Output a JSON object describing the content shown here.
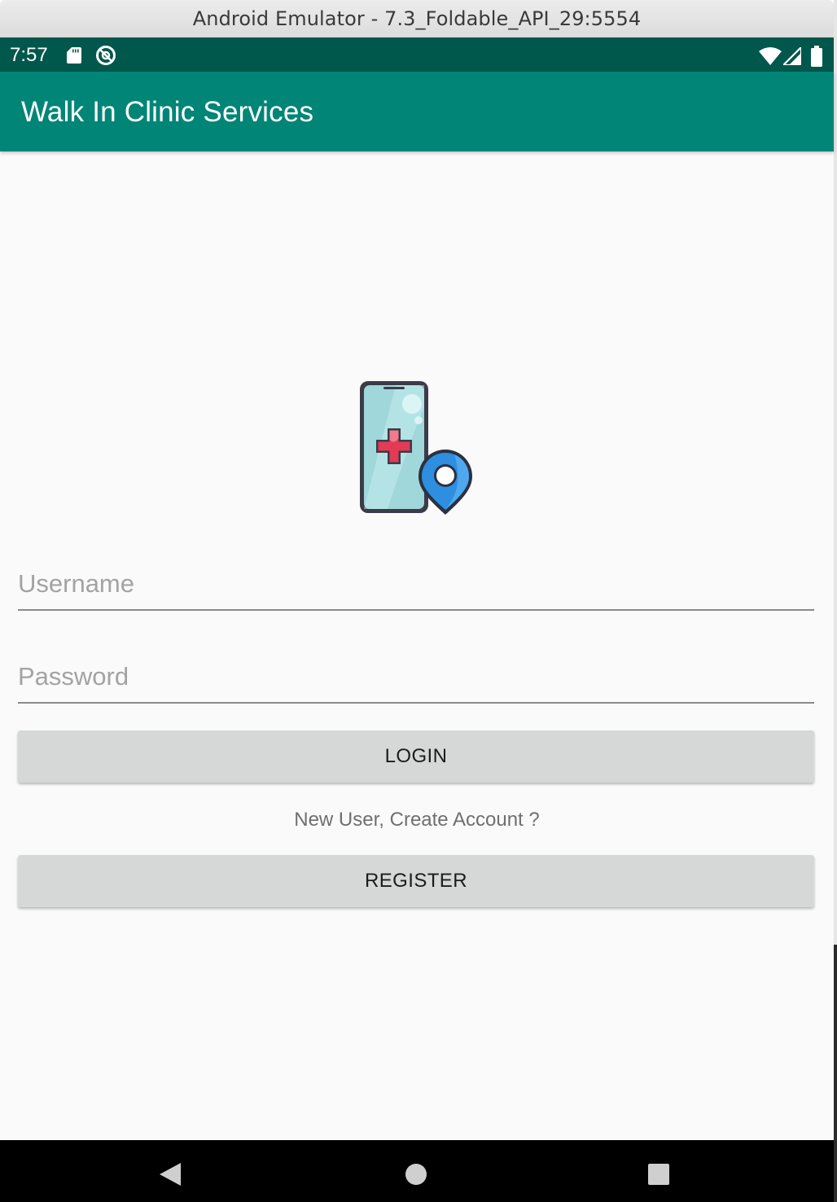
{
  "window": {
    "title": "Android Emulator - 7.3_Foldable_API_29:5554"
  },
  "status_bar": {
    "time": "7:57",
    "left_icons": [
      "sd-card-icon",
      "sync-disabled-icon"
    ],
    "right_icons": [
      "wifi-icon",
      "cellular-signal-icon",
      "battery-icon"
    ]
  },
  "app_bar": {
    "title": "Walk In Clinic Services"
  },
  "login_form": {
    "logo_icon": "phone-medical-cross-location-pin-icon",
    "username_placeholder": "Username",
    "username_value": "",
    "password_placeholder": "Password",
    "password_value": "",
    "login_label": "LOGIN",
    "new_user_text": "New User, Create Account ?",
    "register_label": "REGISTER"
  },
  "nav_bar": {
    "icons": [
      "back-icon",
      "home-icon",
      "recents-icon"
    ]
  },
  "colors": {
    "status_bar": "#00574b",
    "app_bar": "#008577",
    "background": "#fafafa",
    "button": "#d6d7d7"
  }
}
